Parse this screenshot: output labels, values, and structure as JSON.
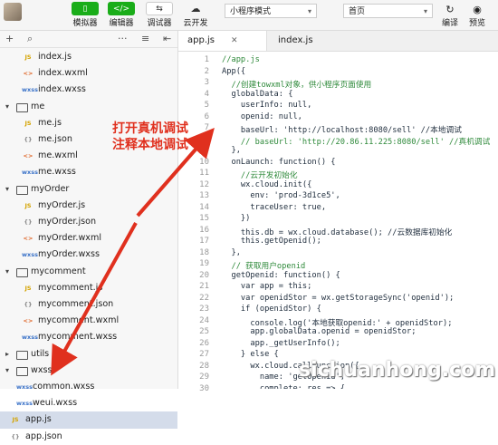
{
  "toolbar": {
    "simulator_label": "模拟器",
    "editor_label": "编辑器",
    "debugger_label": "调试器",
    "cloud_label": "云开发",
    "mode_select": "小程序模式",
    "page_select": "首页",
    "compile_label": "编译",
    "preview_label": "预览"
  },
  "sidebar": {
    "items": [
      {
        "name": "index.js",
        "badge": "JS"
      },
      {
        "name": "index.wxml",
        "badge": "<>"
      },
      {
        "name": "index.wxss",
        "badge": "wxss"
      },
      {
        "name": "me",
        "folder": true
      },
      {
        "name": "me.js",
        "badge": "JS"
      },
      {
        "name": "me.json",
        "badge": "{}"
      },
      {
        "name": "me.wxml",
        "badge": "<>"
      },
      {
        "name": "me.wxss",
        "badge": "wxss"
      },
      {
        "name": "myOrder",
        "folder": true
      },
      {
        "name": "myOrder.js",
        "badge": "JS"
      },
      {
        "name": "myOrder.json",
        "badge": "{}"
      },
      {
        "name": "myOrder.wxml",
        "badge": "<>"
      },
      {
        "name": "myOrder.wxss",
        "badge": "wxss"
      },
      {
        "name": "mycomment",
        "folder": true
      },
      {
        "name": "mycomment.js",
        "badge": "JS"
      },
      {
        "name": "mycomment.json",
        "badge": "{}"
      },
      {
        "name": "mycomment.wxml",
        "badge": "<>"
      },
      {
        "name": "mycomment.wxss",
        "badge": "wxss"
      },
      {
        "name": "utils",
        "folder": true
      },
      {
        "name": "wxss",
        "folder": true
      },
      {
        "name": "common.wxss",
        "badge": "wxss"
      },
      {
        "name": "weui.wxss",
        "badge": "wxss"
      },
      {
        "name": "app.js",
        "badge": "JS"
      },
      {
        "name": "app.json",
        "badge": "{}"
      }
    ]
  },
  "tabs": [
    {
      "label": "app.js"
    },
    {
      "label": "index.js"
    }
  ],
  "editor": {
    "lines": [
      {
        "n": "1",
        "text": "//app.js"
      },
      {
        "n": "2",
        "text": "App({"
      },
      {
        "n": "3",
        "text": "  //创建towxml对象，供小程序页面使用"
      },
      {
        "n": "4",
        "text": "  globalData: {"
      },
      {
        "n": "5",
        "text": "    userInfo: null,"
      },
      {
        "n": "6",
        "text": "    openid: null,"
      },
      {
        "n": "7",
        "text": "    baseUrl: 'http://localhost:8080/sell' //本地调试"
      },
      {
        "n": "8",
        "text": "    // baseUrl: 'http://20.86.11.225:8080/sell' //真机调试"
      },
      {
        "n": "9",
        "text": "  },"
      },
      {
        "n": "10",
        "text": "  onLaunch: function() {"
      },
      {
        "n": "11",
        "text": "    //云开发初始化"
      },
      {
        "n": "12",
        "text": "    wx.cloud.init({"
      },
      {
        "n": "13",
        "text": "      env: 'prod-3d1ce5',"
      },
      {
        "n": "14",
        "text": "      traceUser: true,"
      },
      {
        "n": "15",
        "text": "    })"
      },
      {
        "n": "16",
        "text": "    this.db = wx.cloud.database(); //云数据库初始化"
      },
      {
        "n": "17",
        "text": "    this.getOpenid();"
      },
      {
        "n": "18",
        "text": "  },"
      },
      {
        "n": "19",
        "text": "  // 获取用户openid"
      },
      {
        "n": "20",
        "text": "  getOpenid: function() {"
      },
      {
        "n": "21",
        "text": "    var app = this;"
      },
      {
        "n": "22",
        "text": "    var openidStor = wx.getStorageSync('openid');"
      },
      {
        "n": "23",
        "text": "    if (openidStor) {"
      },
      {
        "n": "24",
        "text": "      console.log('本地获取openid:' + openidStor);"
      },
      {
        "n": "25",
        "text": "      app.globalData.openid = openidStor;"
      },
      {
        "n": "26",
        "text": "      app._getUserInfo();"
      },
      {
        "n": "27",
        "text": "    } else {"
      },
      {
        "n": "28",
        "text": "      wx.cloud.callFunction({"
      },
      {
        "n": "29",
        "text": "        name: 'getOpenid',"
      },
      {
        "n": "30",
        "text": "        complete: res => {"
      }
    ]
  },
  "annotation": {
    "line1": "打开真机调试",
    "line2": "注释本地调试",
    "color": "#e0301e"
  },
  "watermark": "sichuanhong.com"
}
